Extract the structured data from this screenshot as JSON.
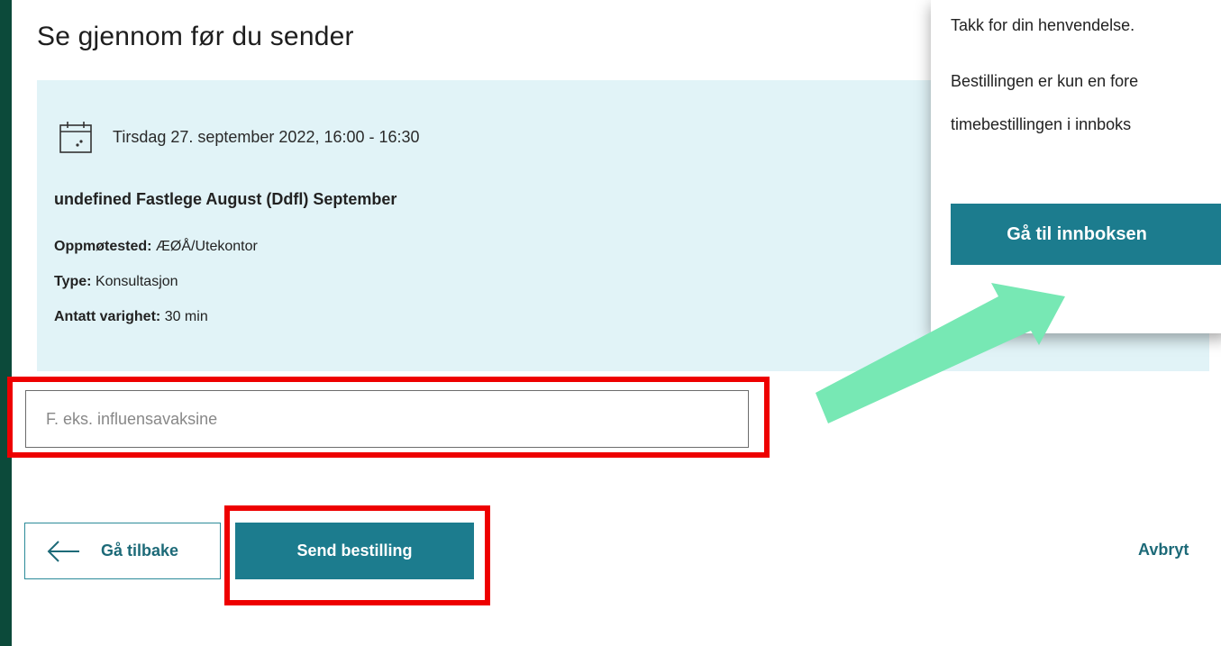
{
  "main": {
    "title": "Se gjennom før du sender",
    "summary": {
      "date": "Tirsdag 27. september 2022, 16:00 - 16:30",
      "doctor": "undefined Fastlege August (Ddfl) September",
      "details": [
        {
          "label": "Oppmøtested:",
          "value": "ÆØÅ/Utekontor"
        },
        {
          "label": "Type:",
          "value": "Konsultasjon"
        },
        {
          "label": "Antatt varighet:",
          "value": "30 min"
        }
      ]
    },
    "reason_input": {
      "placeholder": "F. eks. influensavaksine",
      "value": ""
    },
    "actions": {
      "back": "Gå tilbake",
      "send": "Send bestilling",
      "cancel": "Avbryt"
    }
  },
  "popup": {
    "line1": "Takk for din henvendelse.",
    "line2": "Bestillingen er kun en fore",
    "line3": "timebestillingen i innboks",
    "button": "Gå til innboksen"
  },
  "colors": {
    "background_frame": "#0c4a3a",
    "summary_bg": "#e1f3f7",
    "primary_button": "#1c7c8e",
    "highlight": "#ee0000",
    "arrow": "#77e8b4"
  },
  "icons": {
    "calendar": "calendar-icon",
    "back": "arrow-left-icon",
    "annotation": "annotation-arrow"
  }
}
